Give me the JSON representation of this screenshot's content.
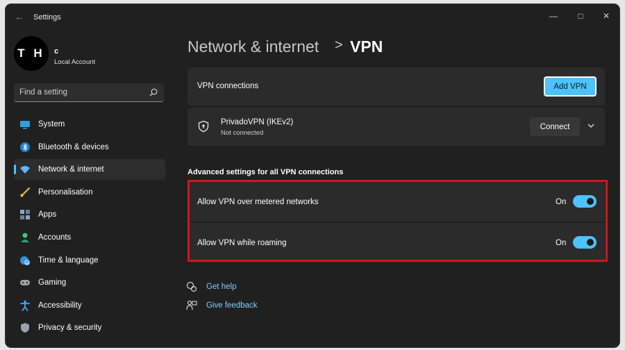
{
  "window": {
    "title": "Settings"
  },
  "account": {
    "initials": "T H",
    "name": "c",
    "type": "Local Account"
  },
  "search": {
    "placeholder": "Find a setting"
  },
  "nav": [
    {
      "label": "System",
      "icon": "monitor-icon",
      "active": false
    },
    {
      "label": "Bluetooth & devices",
      "icon": "bluetooth-icon",
      "active": false
    },
    {
      "label": "Network & internet",
      "icon": "wifi-icon",
      "active": true
    },
    {
      "label": "Personalisation",
      "icon": "brush-icon",
      "active": false
    },
    {
      "label": "Apps",
      "icon": "apps-icon",
      "active": false
    },
    {
      "label": "Accounts",
      "icon": "person-icon",
      "active": false
    },
    {
      "label": "Time & language",
      "icon": "globe-clock-icon",
      "active": false
    },
    {
      "label": "Gaming",
      "icon": "gamepad-icon",
      "active": false
    },
    {
      "label": "Accessibility",
      "icon": "accessibility-icon",
      "active": false
    },
    {
      "label": "Privacy & security",
      "icon": "shield-icon",
      "active": false
    }
  ],
  "breadcrumb": {
    "parent": "Network & internet",
    "separator": ">",
    "current": "VPN"
  },
  "vpn_connections": {
    "label": "VPN connections",
    "add_button": "Add VPN"
  },
  "vpn_profile": {
    "name": "PrivadoVPN (IKEv2)",
    "status": "Not connected",
    "connect_button": "Connect"
  },
  "advanced": {
    "title": "Advanced settings for all VPN connections",
    "settings": [
      {
        "label": "Allow VPN over metered networks",
        "state": "On",
        "enabled": true
      },
      {
        "label": "Allow VPN while roaming",
        "state": "On",
        "enabled": true
      }
    ]
  },
  "links": {
    "help": "Get help",
    "feedback": "Give feedback"
  },
  "colors": {
    "accent": "#4cc2ff",
    "background": "#202020",
    "card": "#2b2b2b",
    "highlight": "#d0161c",
    "link": "#86ccff"
  }
}
